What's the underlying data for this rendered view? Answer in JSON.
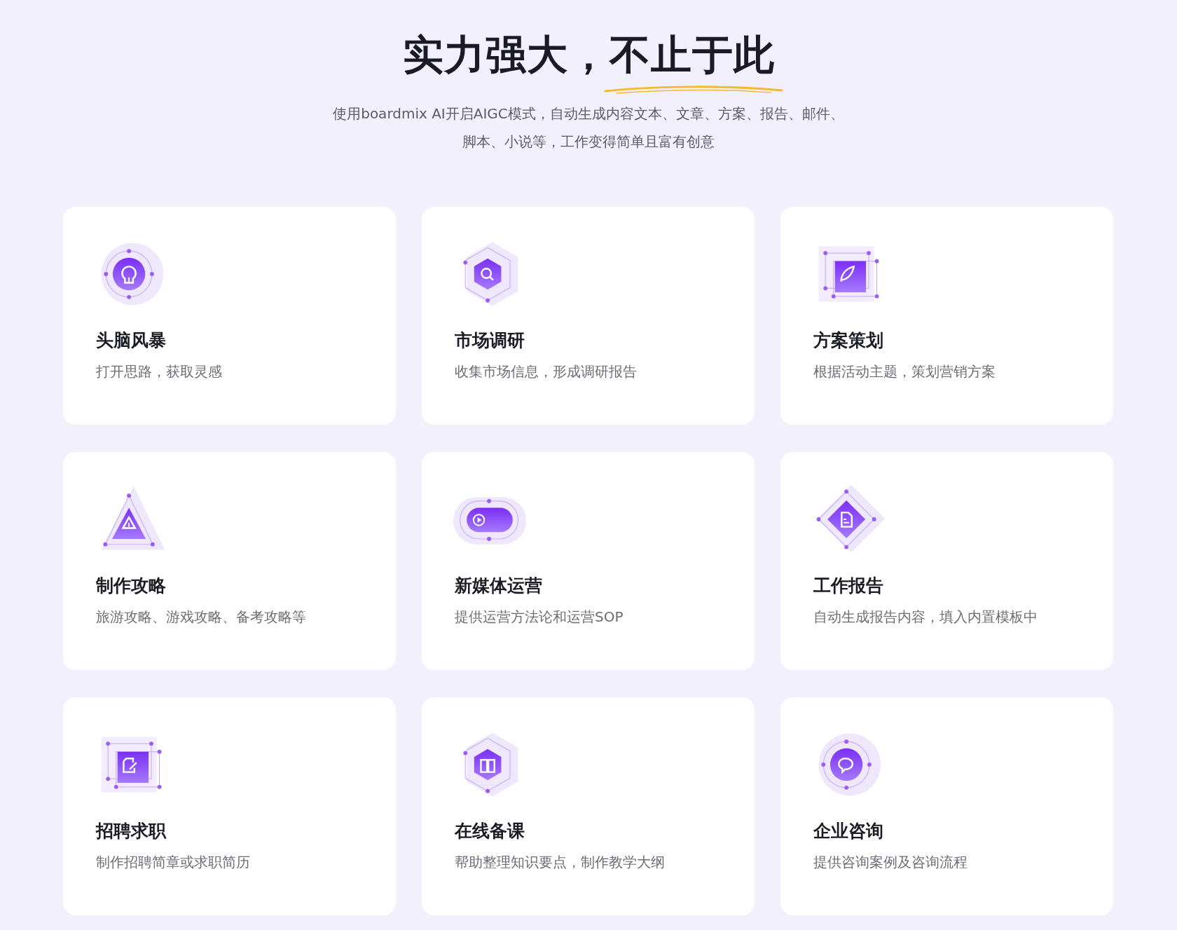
{
  "heading": {
    "lead": "实力强大，",
    "highlight": "不止于此"
  },
  "subtitle_lines": [
    "使用boardmix AI开启AIGC模式，自动生成内容文本、文章、方案、报告、邮件、",
    "脚本、小说等，工作变得简单且富有创意"
  ],
  "cards": [
    {
      "kind": "circle",
      "title": "头脑风暴",
      "description": "打开思路，获取灵感"
    },
    {
      "kind": "hexagon",
      "title": "市场调研",
      "description": "收集市场信息，形成调研报告"
    },
    {
      "kind": "square",
      "title": "方案策划",
      "description": "根据活动主题，策划营销方案"
    },
    {
      "kind": "triangle",
      "title": "制作攻略",
      "description": "旅游攻略、游戏攻略、备考攻略等"
    },
    {
      "kind": "pill",
      "title": "新媒体运营",
      "description": "提供运营方法论和运营SOP"
    },
    {
      "kind": "diamond",
      "title": "工作报告",
      "description": "自动生成报告内容，填入内置模板中"
    },
    {
      "kind": "square",
      "title": "招聘求职",
      "description": "制作招聘简章或求职简历"
    },
    {
      "kind": "hexagon",
      "title": "在线备课",
      "description": "帮助整理知识要点，制作教学大纲"
    },
    {
      "kind": "circle",
      "title": "企业咨询",
      "description": "提供咨询案例及咨询流程"
    }
  ]
}
